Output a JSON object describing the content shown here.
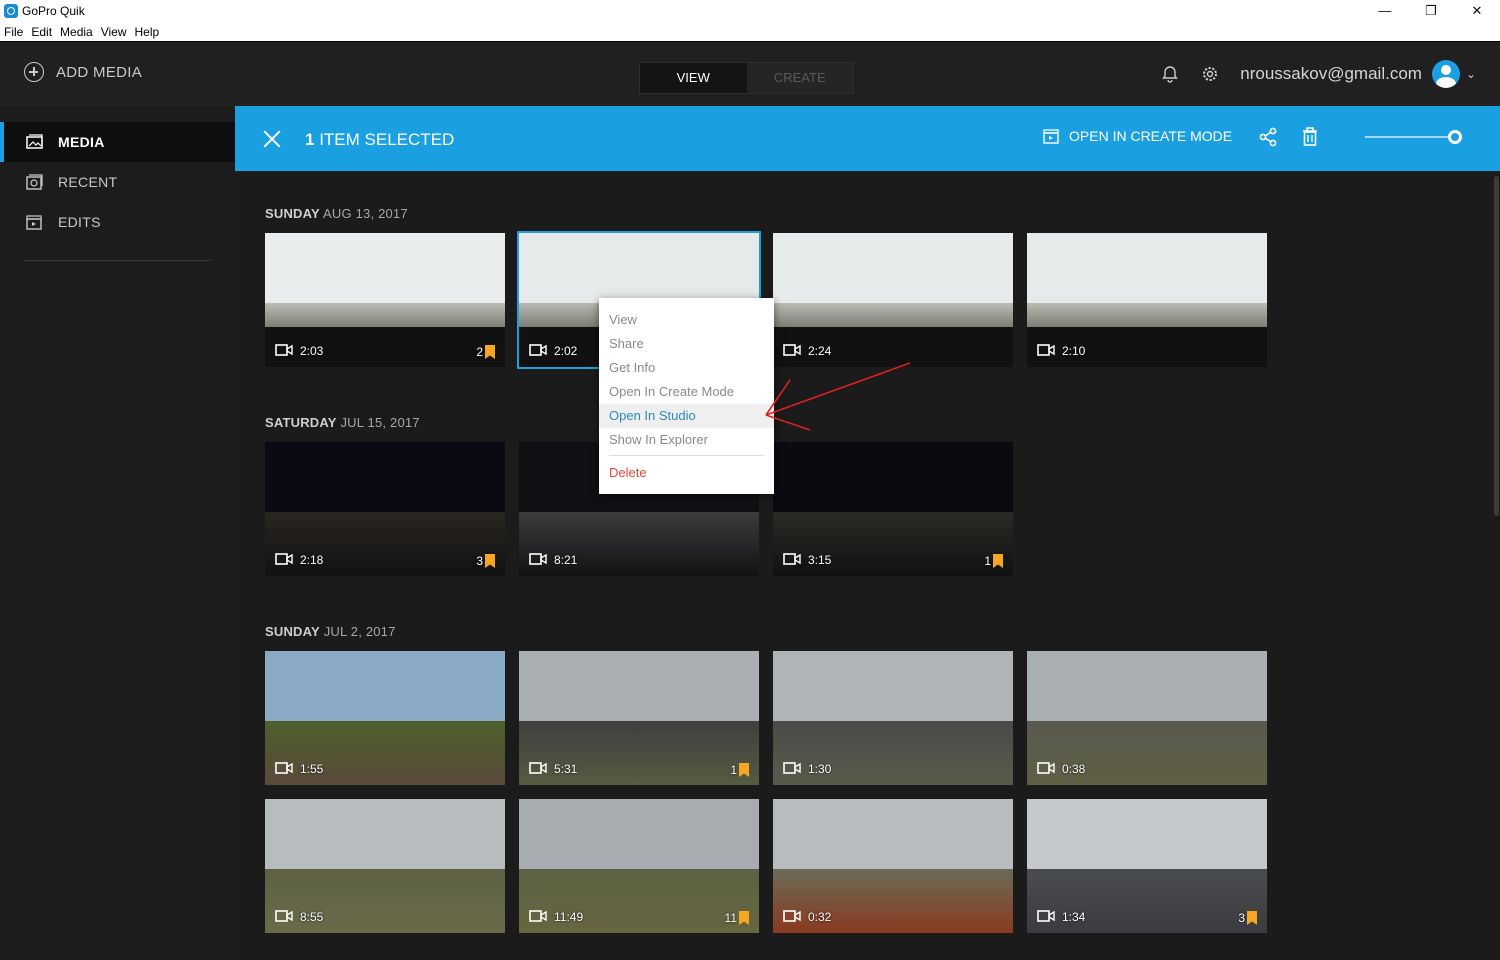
{
  "window": {
    "title": "GoPro Quik",
    "menu": [
      "File",
      "Edit",
      "Media",
      "View",
      "Help"
    ]
  },
  "header": {
    "add_media": "ADD MEDIA",
    "tabs": [
      {
        "label": "VIEW",
        "active": true
      },
      {
        "label": "CREATE",
        "active": false
      }
    ],
    "email": "nroussakov@gmail.com",
    "icons": [
      "bell-icon",
      "gear-icon",
      "avatar",
      "chevron-down-icon"
    ]
  },
  "sidebar": {
    "items": [
      {
        "label": "MEDIA",
        "icon": "media-icon",
        "active": true
      },
      {
        "label": "RECENT",
        "icon": "recent-icon",
        "active": false
      },
      {
        "label": "EDITS",
        "icon": "edits-icon",
        "active": false
      }
    ]
  },
  "selection_bar": {
    "count": "1",
    "label": "ITEM SELECTED",
    "open_create": "OPEN IN CREATE MODE",
    "zoom_level": 1.0
  },
  "groups": [
    {
      "day": "SUNDAY",
      "date": "AUG 13, 2017",
      "items": [
        {
          "duration": "2:03",
          "highlights": "2"
        },
        {
          "duration": "2:02",
          "highlights": "",
          "selected": true
        },
        {
          "duration": "2:24",
          "highlights": ""
        },
        {
          "duration": "2:10",
          "highlights": ""
        }
      ]
    },
    {
      "day": "SATURDAY",
      "date": "JUL 15, 2017",
      "items": [
        {
          "duration": "2:18",
          "highlights": "3"
        },
        {
          "duration": "8:21",
          "highlights": ""
        },
        {
          "duration": "3:15",
          "highlights": "1"
        }
      ]
    },
    {
      "day": "SUNDAY",
      "date": "JUL 2, 2017",
      "items": [
        {
          "duration": "1:55",
          "highlights": ""
        },
        {
          "duration": "5:31",
          "highlights": "1"
        },
        {
          "duration": "1:30",
          "highlights": ""
        },
        {
          "duration": "0:38",
          "highlights": ""
        },
        {
          "duration": "8:55",
          "highlights": ""
        },
        {
          "duration": "11:49",
          "highlights": "11"
        },
        {
          "duration": "0:32",
          "highlights": ""
        },
        {
          "duration": "1:34",
          "highlights": "3"
        }
      ]
    }
  ],
  "context_menu": {
    "items": [
      "View",
      "Share",
      "Get Info",
      "Open In Create Mode",
      "Open In Studio",
      "Show In Explorer"
    ],
    "hovered": "Open In Studio",
    "delete": "Delete"
  },
  "colors": {
    "accent": "#1aa0e0",
    "highlight_tag": "#f5a623",
    "delete": "#e4483c",
    "annotation_arrow": "#e02020"
  }
}
